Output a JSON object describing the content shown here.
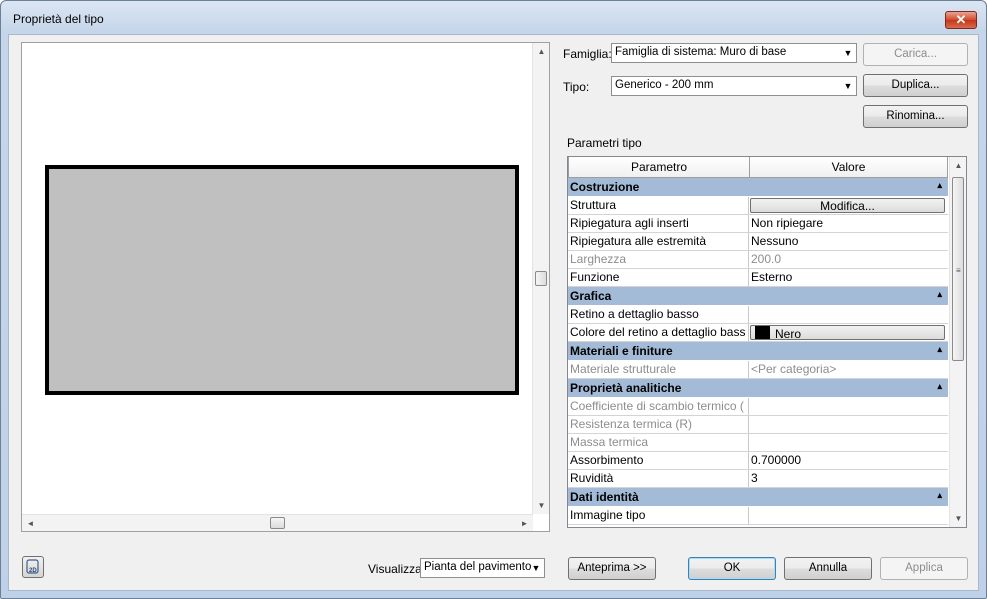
{
  "window": {
    "title": "Proprietà del tipo",
    "close_glyph": "✕"
  },
  "family": {
    "label": "Famiglia:",
    "value": "Famiglia di sistema: Muro di base",
    "load_button": "Carica..."
  },
  "type": {
    "label": "Tipo:",
    "value": "Generico - 200 mm",
    "duplicate_button": "Duplica...",
    "rename_button": "Rinomina..."
  },
  "params": {
    "section_label": "Parametri tipo",
    "col_param": "Parametro",
    "col_value": "Valore",
    "rows": [
      {
        "kind": "group",
        "name": "Costruzione"
      },
      {
        "kind": "row",
        "param": "Struttura",
        "value": "Modifica...",
        "style": "button"
      },
      {
        "kind": "row",
        "param": "Ripiegatura agli inserti",
        "value": "Non ripiegare"
      },
      {
        "kind": "row",
        "param": "Ripiegatura alle estremità",
        "value": "Nessuno"
      },
      {
        "kind": "row",
        "param": "Larghezza",
        "value": "200.0",
        "disabled": true
      },
      {
        "kind": "row",
        "param": "Funzione",
        "value": "Esterno"
      },
      {
        "kind": "group",
        "name": "Grafica"
      },
      {
        "kind": "row",
        "param": "Retino a dettaglio basso",
        "value": ""
      },
      {
        "kind": "row",
        "param": "Colore del retino a dettaglio bass",
        "value": "Nero",
        "style": "color"
      },
      {
        "kind": "group",
        "name": "Materiali e finiture"
      },
      {
        "kind": "row",
        "param": "Materiale strutturale",
        "value": "<Per categoria>",
        "disabled": true
      },
      {
        "kind": "group",
        "name": "Proprietà analitiche"
      },
      {
        "kind": "row",
        "param": "Coefficiente di scambio termico (",
        "value": "",
        "disabled": true
      },
      {
        "kind": "row",
        "param": "Resistenza termica (R)",
        "value": "",
        "disabled": true
      },
      {
        "kind": "row",
        "param": "Massa termica",
        "value": "",
        "disabled": true
      },
      {
        "kind": "row",
        "param": "Assorbimento",
        "value": "0.700000"
      },
      {
        "kind": "row",
        "param": "Ruvidità",
        "value": "3"
      },
      {
        "kind": "group",
        "name": "Dati identità"
      },
      {
        "kind": "row",
        "param": "Immagine tipo",
        "value": ""
      }
    ]
  },
  "footer": {
    "view_label": "Visualizza:",
    "view_value": "Pianta del pavimento",
    "preview_button": "Anteprima >>",
    "ok_button": "OK",
    "cancel_button": "Annulla",
    "apply_button": "Applica"
  },
  "colors": {
    "wall_fill": "#c0c0c0",
    "group_header": "#a3bbd6"
  }
}
